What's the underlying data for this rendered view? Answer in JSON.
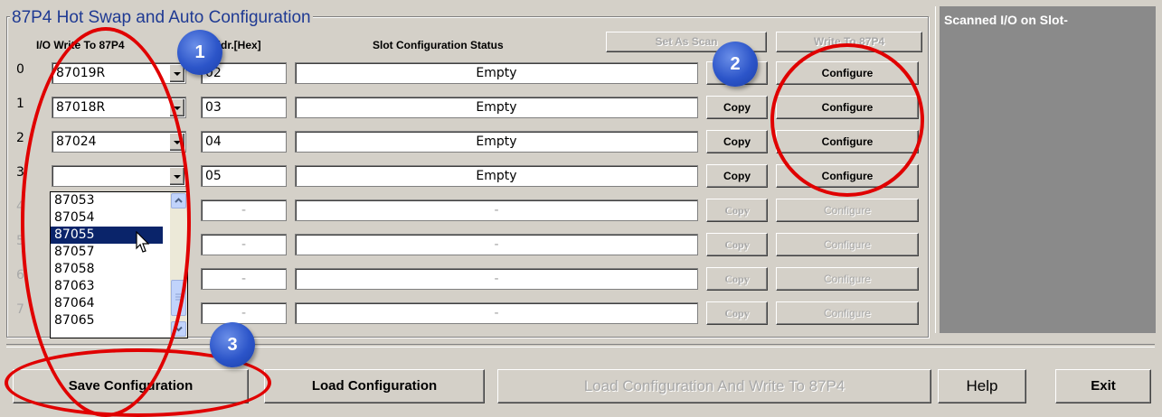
{
  "window": {
    "group_title": "87P4 Hot Swap and Auto Configuration",
    "scan_title": "Scanned I/O on Slot-"
  },
  "headers": {
    "io_write": "I/O Write To 87P4",
    "addr": "Addr.[Hex]",
    "status": "Slot Configuration Status",
    "set_as_scan": "Set As Scan",
    "write_to": "Write To 87P4"
  },
  "rows": [
    {
      "slot": "0",
      "module": "87019R",
      "addr": "02",
      "status": "Empty",
      "copy": "Copy",
      "configure": "Configure",
      "scan": ""
    },
    {
      "slot": "1",
      "module": "87018R",
      "addr": "03",
      "status": "Empty",
      "copy": "Copy",
      "configure": "Configure",
      "scan": ""
    },
    {
      "slot": "2",
      "module": "87024",
      "addr": "04",
      "status": "Empty",
      "copy": "Copy",
      "configure": "Configure",
      "scan": ""
    },
    {
      "slot": "3",
      "module": "",
      "addr": "05",
      "status": "Empty",
      "copy": "Copy",
      "configure": "Configure",
      "scan": ""
    },
    {
      "slot": "4",
      "module": "",
      "addr": "-",
      "status": "-",
      "copy": "Copy",
      "configure": "Configure",
      "scan": "-"
    },
    {
      "slot": "5",
      "module": "",
      "addr": "-",
      "status": "-",
      "copy": "Copy",
      "configure": "Configure",
      "scan": "-"
    },
    {
      "slot": "6",
      "module": "",
      "addr": "-",
      "status": "-",
      "copy": "Copy",
      "configure": "Configure",
      "scan": "-"
    },
    {
      "slot": "7",
      "module": "",
      "addr": "-",
      "status": "-",
      "copy": "Copy",
      "configure": "Configure",
      "scan": "-"
    }
  ],
  "dropdown": {
    "items": [
      "87053",
      "87054",
      "87055",
      "87057",
      "87058",
      "87063",
      "87064",
      "87065"
    ],
    "selected": "87055"
  },
  "bottom": {
    "save": "Save Configuration",
    "load": "Load Configuration",
    "load_write": "Load  Configuration And Write To 87P4",
    "help": "Help",
    "exit": "Exit"
  },
  "annotations": {
    "badge1": "1",
    "badge2": "2",
    "badge3": "3",
    "ring_color": "#e00000",
    "badge_color": "#2c55c9"
  },
  "icons": {
    "cursor": "mouse-pointer-icon",
    "dropdown_arrow": "chevron-down-icon",
    "scroll_up": "scroll-up-icon",
    "scroll_down": "scroll-down-icon"
  }
}
